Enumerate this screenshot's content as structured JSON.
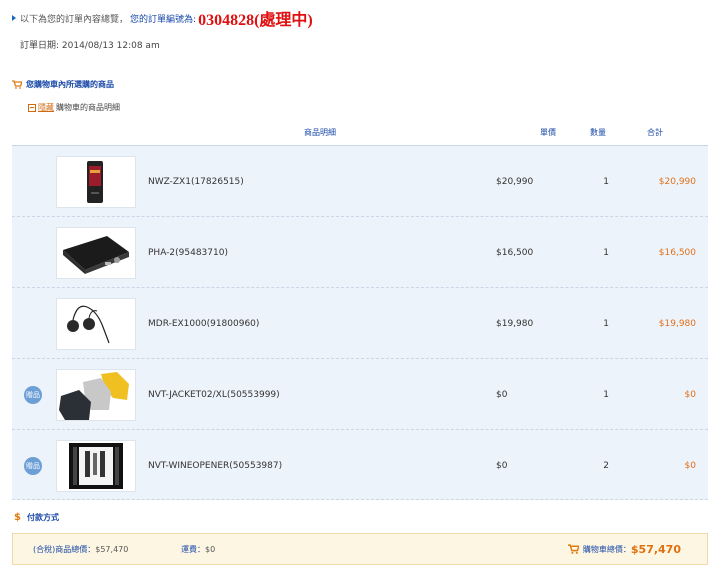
{
  "order": {
    "intro": "以下為您的訂單內容總覽，",
    "number_label": "您的訂單編號為:",
    "number": "0304828(處理中)",
    "date": "訂單日期: 2014/08/13 12:08 am"
  },
  "cart": {
    "section_title": "您購物車內所選購的商品",
    "hide_link": "隱藏",
    "detail_label": "購物車的商品明細",
    "headers": {
      "detail": "商品明細",
      "price": "單價",
      "qty": "數量",
      "total": "合計"
    },
    "items": [
      {
        "name": "NWZ-ZX1(17826515)",
        "price": "$20,990",
        "qty": "1",
        "total": "$20,990",
        "gift": "",
        "image": "walkman-player"
      },
      {
        "name": "PHA-2(95483710)",
        "price": "$16,500",
        "qty": "1",
        "total": "$16,500",
        "gift": "",
        "image": "headphone-amplifier"
      },
      {
        "name": "MDR-EX1000(91800960)",
        "price": "$19,980",
        "qty": "1",
        "total": "$19,980",
        "gift": "",
        "image": "in-ear-earphones"
      },
      {
        "name": "NVT-JACKET02/XL(50553999)",
        "price": "$0",
        "qty": "1",
        "total": "$0",
        "gift": "贈品",
        "image": "jackets"
      },
      {
        "name": "NVT-WINEOPENER(50553987)",
        "price": "$0",
        "qty": "2",
        "total": "$0",
        "gift": "贈品",
        "image": "wine-opener-set"
      }
    ]
  },
  "payment": {
    "title": "付款方式",
    "icon": "$"
  },
  "summary": {
    "subtotal_label": "(合稅)商品總價：",
    "subtotal": "$57,470",
    "shipping_label": "運費：",
    "shipping": "$0",
    "grand_label": "購物車總價：",
    "grand": "$57,470"
  },
  "colors": {
    "link_blue": "#1a49a8",
    "order_red": "#e01010",
    "total_orange": "#e0701c",
    "row_bg": "#edf3fa",
    "summary_bg": "#fdf6e2"
  }
}
